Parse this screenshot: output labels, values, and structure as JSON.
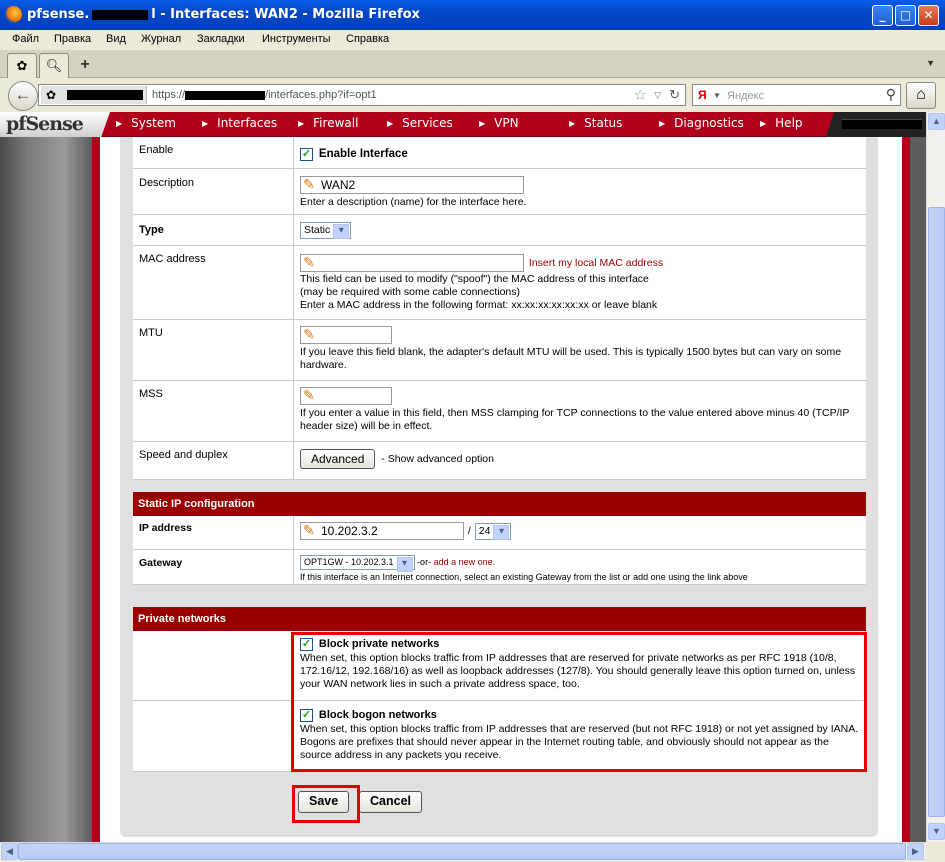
{
  "window": {
    "title_prefix": "pfsense.",
    "title_suffix": "l - Interfaces: WAN2 - Mozilla Firefox",
    "min": "_",
    "max": "□",
    "close": "✕"
  },
  "menubar": [
    "Файл",
    "Правка",
    "Вид",
    "Журнал",
    "Закладки",
    "Инструменты",
    "Справка"
  ],
  "tabs": {
    "new_tab": "+"
  },
  "address": {
    "url_prefix": "https://",
    "url_suffix": "/interfaces.php?if=opt1"
  },
  "search": {
    "engine": "Я",
    "placeholder": "Яндекс"
  },
  "pfsense": {
    "logo": "pfSense",
    "nav": [
      "System",
      "Interfaces",
      "Firewall",
      "Services",
      "VPN",
      "Status",
      "Diagnostics",
      "Help"
    ]
  },
  "form": {
    "enable": {
      "label": "Enable",
      "checkbox_label": "Enable Interface",
      "checked": true
    },
    "description": {
      "label": "Description",
      "value": "WAN2",
      "hint": "Enter a description (name) for the interface here."
    },
    "type": {
      "label": "Type",
      "value": "Static"
    },
    "mac": {
      "label": "MAC address",
      "value": "",
      "insert_link": "Insert my local MAC address",
      "hint1": "This field can be used to modify (\"spoof\") the MAC address of this interface",
      "hint2": "(may be required with some cable connections)",
      "hint3": "Enter a MAC address in the following format: xx:xx:xx:xx:xx:xx or leave blank"
    },
    "mtu": {
      "label": "MTU",
      "value": "",
      "hint": "If you leave this field blank, the adapter's default MTU will be used. This is typically 1500 bytes but can vary on some hardware."
    },
    "mss": {
      "label": "MSS",
      "value": "",
      "hint": "If you enter a value in this field, then MSS clamping for TCP connections to the value entered above minus 40 (TCP/IP header size) will be in effect."
    },
    "speed": {
      "label": "Speed and duplex",
      "button": "Advanced",
      "hint": "- Show advanced option"
    },
    "static_section": "Static IP configuration",
    "ip": {
      "label": "IP address",
      "value": "10.202.3.2",
      "slash": "/",
      "mask": "24"
    },
    "gateway": {
      "label": "Gateway",
      "value": "OPT1GW - 10.202.3.1",
      "or": "-or-",
      "add_link": "add a new one.",
      "hint": "If this interface is an Internet connection, select an existing Gateway from the list or add one using the link above"
    },
    "private_section": "Private networks",
    "block_private": {
      "label": "Block private networks",
      "checked": true,
      "hint": "When set, this option blocks traffic from IP addresses that are reserved for private networks as per RFC 1918 (10/8, 172.16/12, 192.168/16) as well as loopback addresses (127/8).   You should generally leave this option turned on, unless your WAN network lies in such a private address space, too."
    },
    "block_bogon": {
      "label": "Block bogon networks",
      "checked": true,
      "hint": "When set, this option blocks traffic from IP addresses that are reserved (but not RFC 1918) or not yet assigned by IANA.   Bogons are prefixes that should never appear in the Internet routing table, and obviously should not appear as the source address in any packets you receive."
    },
    "save": "Save",
    "cancel": "Cancel",
    "check_mark": "✓"
  },
  "colors": {
    "pfsense_red": "#b1001b",
    "section_red": "#990000",
    "highlight": "#e00000"
  }
}
